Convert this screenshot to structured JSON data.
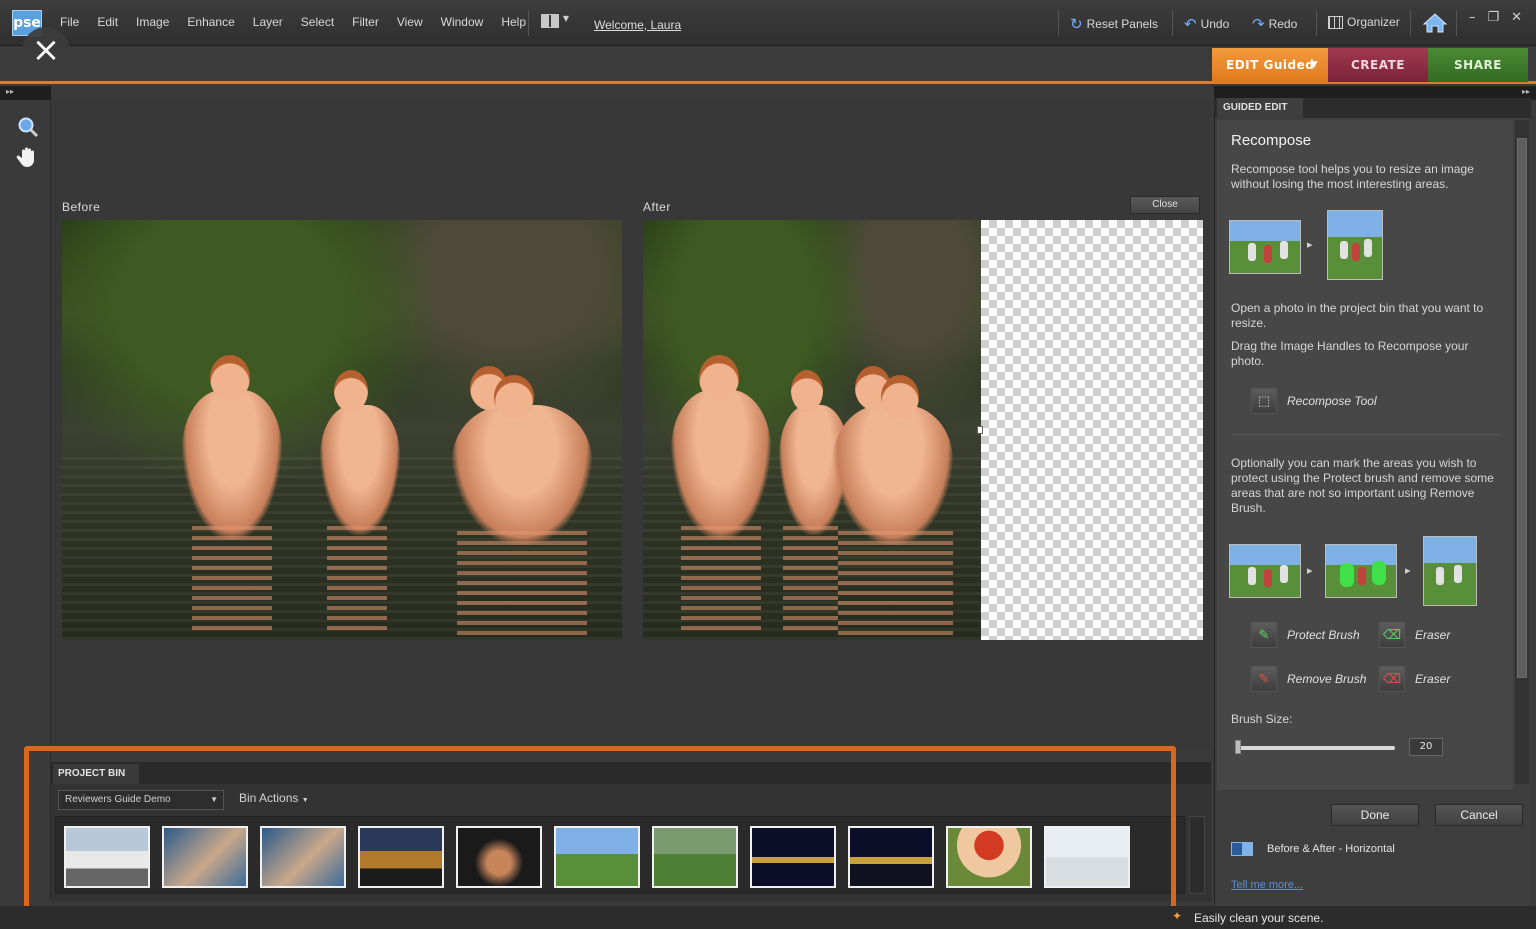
{
  "app": {
    "logo": "pse"
  },
  "menu": [
    "File",
    "Edit",
    "Image",
    "Enhance",
    "Layer",
    "Select",
    "Filter",
    "View",
    "Window",
    "Help"
  ],
  "toolbar": {
    "welcome": "Welcome, Laura",
    "reset_panels": "Reset Panels",
    "undo": "Undo",
    "redo": "Redo",
    "organizer": "Organizer"
  },
  "mode_tabs": {
    "edit": "EDIT Guided",
    "create": "CREATE",
    "share": "SHARE"
  },
  "canvas": {
    "before_label": "Before",
    "after_label": "After",
    "close_label": "Close"
  },
  "guided": {
    "panel_tab": "GUIDED EDIT",
    "title": "Recompose",
    "intro": "Recompose tool helps you to resize an image without losing the most interesting areas.",
    "step1": "Open a photo in the project bin that you want to resize.",
    "step2": "Drag the Image Handles to Recompose your photo.",
    "recompose_tool": "Recompose Tool",
    "optional": "Optionally you can mark the areas you wish to protect using the Protect brush and remove some areas that are not so important using Remove Brush.",
    "protect_brush": "Protect Brush",
    "eraser1": "Eraser",
    "remove_brush": "Remove Brush",
    "eraser2": "Eraser",
    "brush_size_label": "Brush Size:",
    "brush_size_value": "20",
    "done": "Done",
    "cancel": "Cancel",
    "view_mode": "Before & After - Horizontal",
    "tell_me_more": "Tell me more..."
  },
  "bin": {
    "tab": "PROJECT BIN",
    "album": "Reviewers Guide Demo",
    "actions": "Bin Actions"
  },
  "status": "Easily clean your scene.",
  "colors": {
    "accent_orange": "#e07a2d",
    "create": "#8a2a42",
    "share": "#3f7a2c"
  }
}
